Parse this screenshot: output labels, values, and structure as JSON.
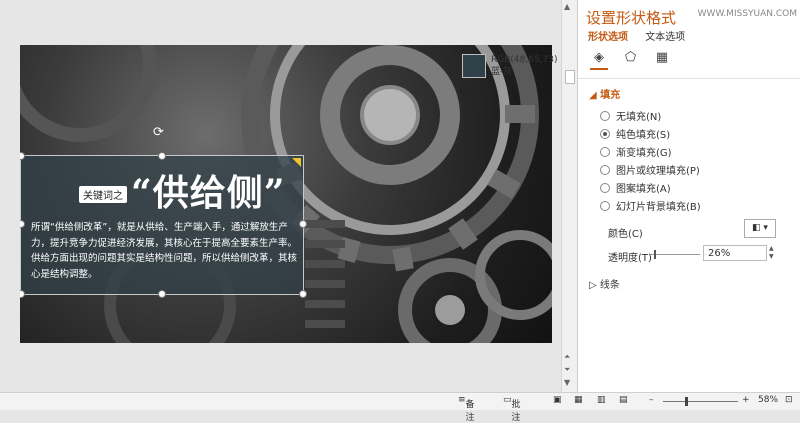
{
  "tooltip": {
    "rgb": "RGB(48,65,73)",
    "name": "蓝-灰",
    "swatch_color": "#304149"
  },
  "slide": {
    "tag": "关键词之",
    "title": "“供给侧”",
    "body": "所谓“供给侧改革”，就是从供给、生产端入手，通过解放生产力，提升竞争力促进经济发展，其核心在于提高全要素生产率。供给方面出现的问题其实是结构性问题，所以供给侧改革，其核心是结构调整。"
  },
  "panel": {
    "title": "设置形状格式",
    "watermark": "WWW.MISSYUAN.COM",
    "tabs": [
      "形状选项",
      "文本选项"
    ],
    "section_fill": "填充",
    "fill_options": [
      "无填充(N)",
      "纯色填充(S)",
      "渐变填充(G)",
      "图片或纹理填充(P)",
      "图案填充(A)",
      "幻灯片背景填充(B)"
    ],
    "selected_fill": 1,
    "color_label": "颜色(C)",
    "transparency_label": "透明度(T)",
    "transparency_value": "26%",
    "section_line": "线条"
  },
  "status": {
    "notes": "备注",
    "comments": "批注",
    "zoom": "58%",
    "minus": "–",
    "plus": "+"
  },
  "colors": {
    "accent": "#c55a11",
    "overlay": "#304149"
  }
}
